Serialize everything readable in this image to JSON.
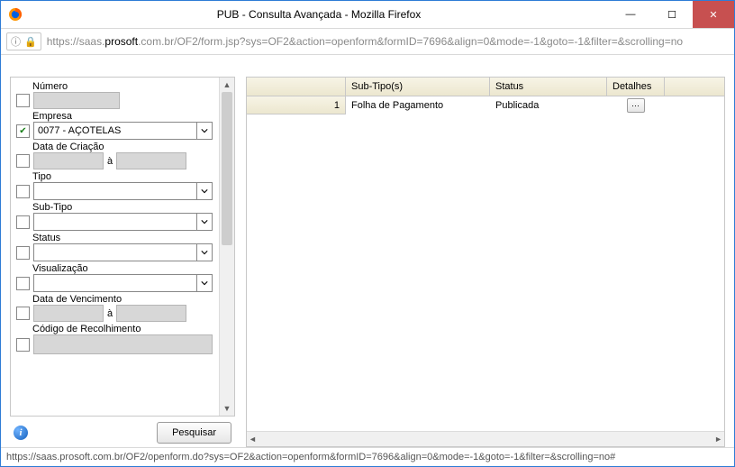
{
  "window": {
    "title": "PUB - Consulta Avançada - Mozilla Firefox"
  },
  "url": {
    "identity_glyph": "ⓘ",
    "scheme_host_pre": "https://saas.",
    "host_bold": "prosoft",
    "host_post": ".com.br",
    "path": "/OF2/form.jsp?sys=OF2&action=openform&formID=7696&align=0&mode=-1&goto=-1&filter=&scrolling=no"
  },
  "filters": {
    "numero": {
      "label": "Número"
    },
    "empresa": {
      "label": "Empresa",
      "value": "0077 - AÇOTELAS",
      "checked": true
    },
    "data_criacao": {
      "label": "Data de Criação",
      "sep": "à"
    },
    "tipo": {
      "label": "Tipo"
    },
    "sub_tipo": {
      "label": "Sub-Tipo"
    },
    "status": {
      "label": "Status"
    },
    "visualizacao": {
      "label": "Visualização"
    },
    "data_vencimento": {
      "label": "Data de Vencimento",
      "sep": "à"
    },
    "codigo_recolhimento": {
      "label": "Código de Recolhimento"
    }
  },
  "actions": {
    "pesquisar": "Pesquisar"
  },
  "grid": {
    "headers": {
      "c1": "Sub-Tipo(s)",
      "c2": "Status",
      "c3": "Detalhes"
    },
    "rows": [
      {
        "n": "1",
        "subtipo": "Folha de Pagamento",
        "status": "Publicada"
      }
    ]
  },
  "statusbar": "https://saas.prosoft.com.br/OF2/openform.do?sys=OF2&action=openform&formID=7696&align=0&mode=-1&goto=-1&filter=&scrolling=no#"
}
